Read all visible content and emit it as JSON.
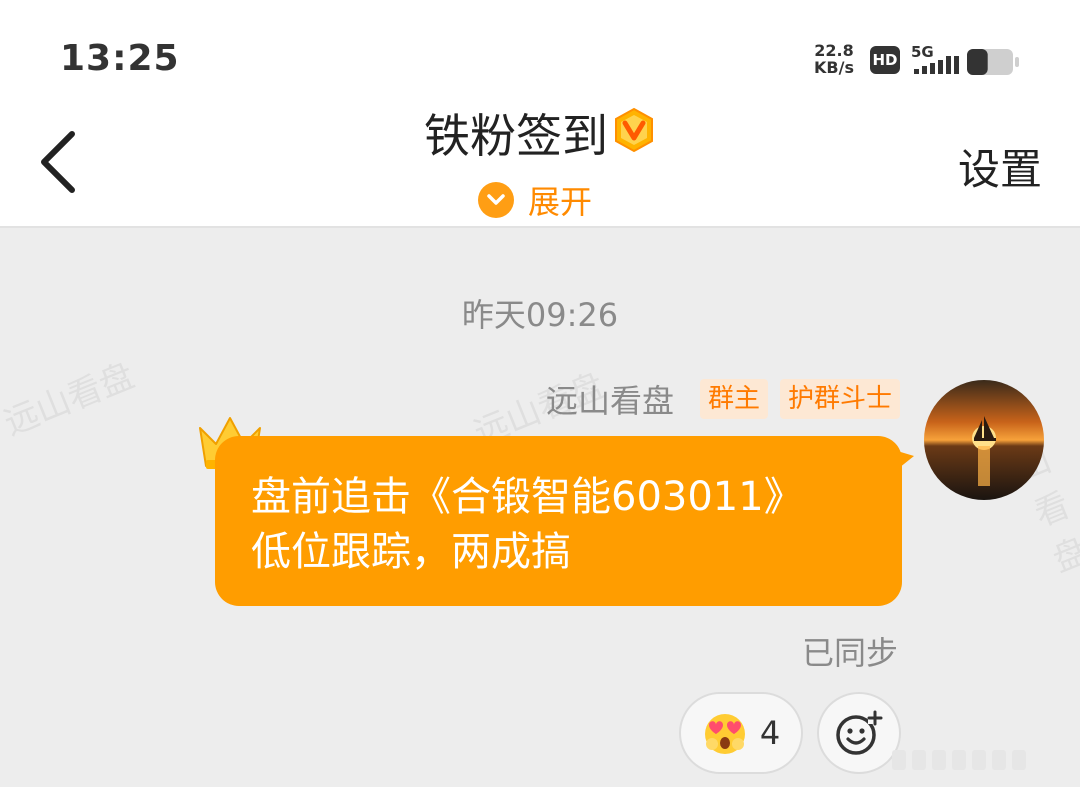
{
  "status_bar": {
    "time": "13:25",
    "network_speed_value": "22.8",
    "network_speed_unit": "KB/s",
    "hd_label": "HD",
    "network_type": "5G",
    "battery_level": 0.45
  },
  "header": {
    "title": "铁粉签到",
    "badge_icon": "v-badge-icon",
    "expand_label": "展开",
    "settings_label": "设置",
    "back_icon": "chevron-left-icon"
  },
  "watermark_text": "远山看盘",
  "chat": {
    "timestamp": "昨天09:26",
    "message": {
      "sender": "远山看盘",
      "tags": [
        "群主",
        "护群斗士"
      ],
      "line1": "盘前追击《合锻智能603011》",
      "line2": "低位跟踪，两成搞",
      "status": "已同步",
      "reaction": {
        "icon": "heart-eyes-emoji-icon",
        "count": "4"
      }
    }
  },
  "colors": {
    "accent": "#ff9d00",
    "accent_text": "#ff8a00",
    "tag_bg": "#fde8d4",
    "background": "#ededed"
  }
}
